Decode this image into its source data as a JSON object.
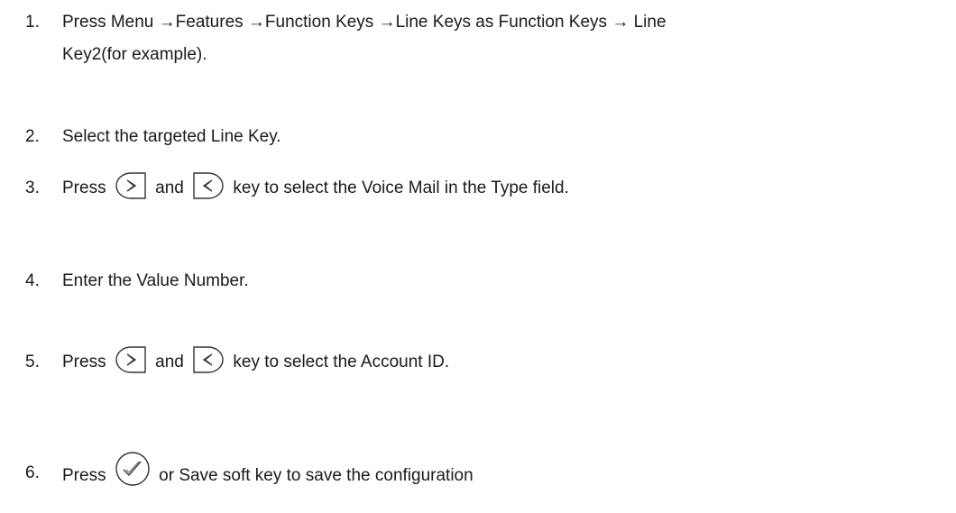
{
  "steps": [
    {
      "number": "1.",
      "line1": "Press Menu →Features →Function Keys →Line Keys as Function Keys → Line",
      "line2": "Key2(for example)."
    },
    {
      "number": "2.",
      "text": "Select the targeted Line Key."
    },
    {
      "number": "3.",
      "prefix": "Press",
      "mid": "and",
      "suffix": "key to select the Voice Mail in the Type field.",
      "icons": [
        "right-navigation-key-icon",
        "left-navigation-key-icon"
      ]
    },
    {
      "number": "4.",
      "text": "Enter the Value Number."
    },
    {
      "number": "5.",
      "prefix": "Press",
      "mid": "and",
      "suffix": "key to select the Account ID.",
      "icons": [
        "right-navigation-key-icon",
        "left-navigation-key-icon"
      ]
    },
    {
      "number": "6.",
      "prefix": "Press",
      "suffix": "or Save soft key to save the configuration",
      "icons": [
        "ok-key-icon"
      ]
    }
  ]
}
